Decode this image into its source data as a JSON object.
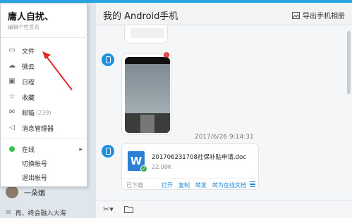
{
  "window": {
    "accent_color": "#2aa4e0"
  },
  "chat": {
    "title": "我的 Android手机",
    "export_label": "导出手机相册",
    "timestamp": "2017/6/26 9:14:31",
    "file": {
      "name": "201706231708社保补贴申请.doc",
      "size": "22.00K",
      "status": "已下载",
      "actions": [
        "打开",
        "复制",
        "转发",
        "转为在线文档"
      ],
      "icon_letter": "W"
    }
  },
  "menu": {
    "username": "庸人自扰、",
    "signature": "编辑个性签名",
    "items": [
      {
        "label": "文件",
        "icon": "folder-icon"
      },
      {
        "label": "微云",
        "icon": "cloud-icon"
      },
      {
        "label": "日程",
        "icon": "calendar-icon"
      },
      {
        "label": "收藏",
        "icon": "star-icon"
      },
      {
        "label": "邮箱",
        "count": "(239)",
        "icon": "mail-icon"
      },
      {
        "label": "消息管理器",
        "icon": "speaker-icon"
      }
    ],
    "status": "在线",
    "switch_account": "切换帐号",
    "logout": "退出帐号"
  },
  "left_list": {
    "contact_name": "一朵烟",
    "bottom_text": "再，终会融入大海"
  }
}
